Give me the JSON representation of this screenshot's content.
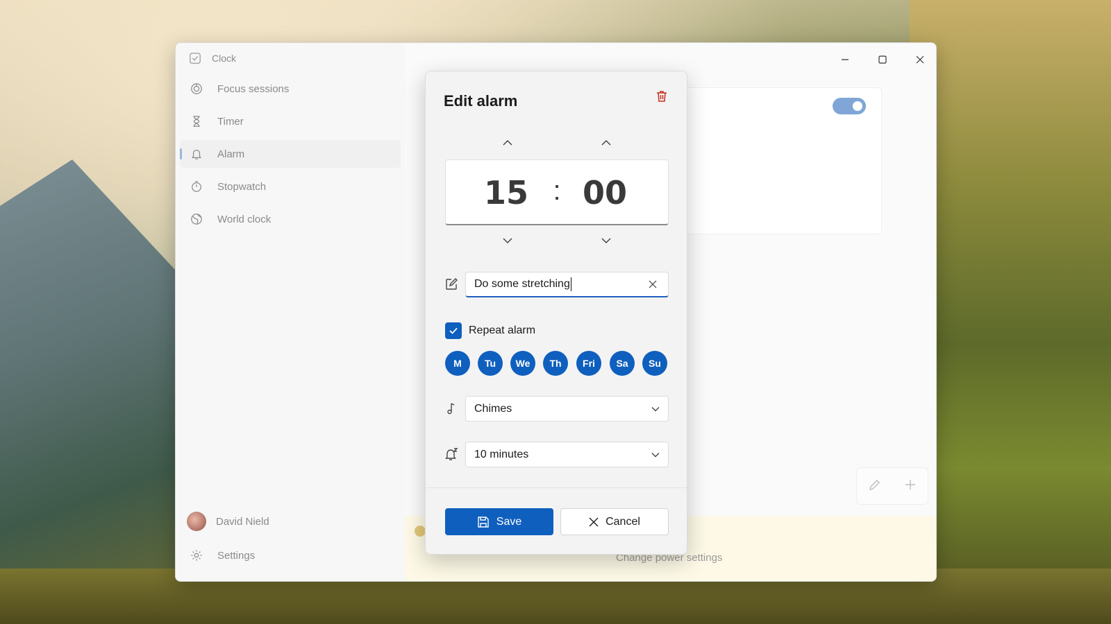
{
  "app": {
    "title": "Clock"
  },
  "sidebar": {
    "items": [
      {
        "label": "Focus sessions",
        "icon": "focus-icon"
      },
      {
        "label": "Timer",
        "icon": "hourglass-icon"
      },
      {
        "label": "Alarm",
        "icon": "bell-icon",
        "active": true
      },
      {
        "label": "Stopwatch",
        "icon": "stopwatch-icon"
      },
      {
        "label": "World clock",
        "icon": "globe-icon"
      }
    ],
    "user": {
      "name": "David Nield"
    },
    "settings_label": "Settings"
  },
  "main": {
    "power_link": "Change power settings",
    "alarm_toggle_on": true
  },
  "dialog": {
    "title": "Edit alarm",
    "hours": "15",
    "separator": ":",
    "minutes": "00",
    "alarm_name": "Do some stretching",
    "repeat_label": "Repeat alarm",
    "repeat_checked": true,
    "days": [
      "M",
      "Tu",
      "We",
      "Th",
      "Fri",
      "Sa",
      "Su"
    ],
    "sound": "Chimes",
    "snooze": "10 minutes",
    "save_label": "Save",
    "cancel_label": "Cancel"
  },
  "colors": {
    "accent": "#0f5fbe",
    "delete": "#c42b1c",
    "toggle": "#7fa6d6",
    "power_bar": "#fdf9e6"
  }
}
